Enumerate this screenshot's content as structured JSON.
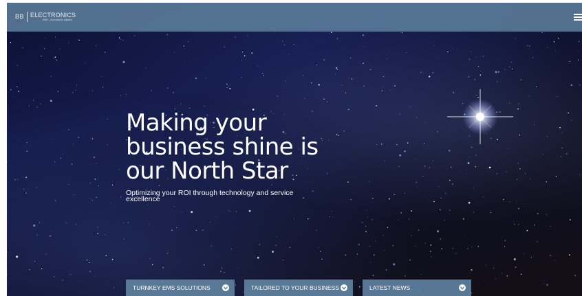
{
  "brand": {
    "logo_mark": "BB",
    "logo_name": "ELECTRONICS",
    "logo_tagline": "EMS – from idea to solution"
  },
  "header": {
    "menu_icon": "hamburger-menu-icon"
  },
  "hero": {
    "headline": "Making your\nbusiness shine is\nour North Star",
    "subtitle": "Optimizing your ROI through technology and service excellence"
  },
  "cta_buttons": [
    {
      "label": "TURNKEY EMS SOLUTIONS",
      "icon": "chevron-down-icon"
    },
    {
      "label": "TAILORED TO YOUR BUSINESS",
      "icon": "chevron-down-icon"
    },
    {
      "label": "LATEST NEWS",
      "icon": "chevron-down-icon"
    }
  ],
  "colors": {
    "nav_bar": "#5c7d9b",
    "cta_button": "#5c7d9b",
    "text": "#ffffff",
    "sky_dark": "#0d0f24",
    "sky_blue": "#131a48"
  }
}
